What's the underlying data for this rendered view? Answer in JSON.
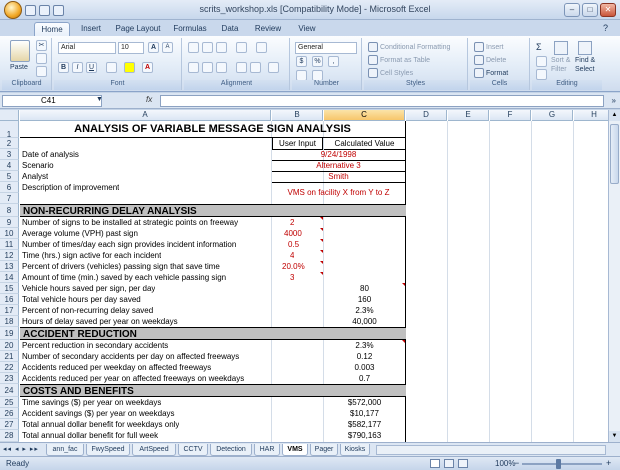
{
  "window": {
    "title": "scrits_workshop.xls  [Compatibility Mode] - Microsoft Excel"
  },
  "ribbon": {
    "tabs": [
      "Home",
      "Insert",
      "Page Layout",
      "Formulas",
      "Data",
      "Review",
      "View"
    ],
    "active_tab": "Home",
    "clipboard": {
      "paste": "Paste",
      "label": "Clipboard"
    },
    "font": {
      "name": "Arial",
      "size": "10",
      "label": "Font",
      "bold": "B",
      "italic": "I",
      "underline": "U",
      "grow": "A",
      "shrink": "A",
      "fontcolor": "A"
    },
    "alignment": {
      "label": "Alignment"
    },
    "number": {
      "format": "General",
      "currency": "$",
      "percent": "%",
      "comma": ",",
      "label": "Number"
    },
    "styles": {
      "conditional": "Conditional Formatting",
      "table": "Format as Table",
      "cell": "Cell Styles",
      "label": "Styles"
    },
    "cells": {
      "insert": "Insert",
      "delete": "Delete",
      "format": "Format",
      "label": "Cells"
    },
    "editing": {
      "sigma": "Σ",
      "sort": "Sort &",
      "filter": "Filter",
      "find": "Find &",
      "select": "Select",
      "label": "Editing"
    }
  },
  "formula_bar": {
    "name_box": "C41",
    "fx": "fx",
    "value": ""
  },
  "columns": [
    "A",
    "B",
    "C",
    "D",
    "E",
    "F",
    "G",
    "H"
  ],
  "selected_column": "C",
  "rows": [
    "1",
    "2",
    "3",
    "4",
    "5",
    "6",
    "7",
    "8",
    "9",
    "10",
    "11",
    "12",
    "13",
    "14",
    "15",
    "16",
    "17",
    "18",
    "19",
    "20",
    "21",
    "22",
    "23",
    "24",
    "25",
    "26",
    "27",
    "28"
  ],
  "sheet": {
    "title": "ANALYSIS OF VARIABLE MESSAGE SIGN ANALYSIS",
    "header_user_input": "User Input",
    "header_calculated": "Calculated Value",
    "date_label": "Date of analysis",
    "date_value": "9/24/1998",
    "scenario_label": "Scenario",
    "scenario_value": "Alternative 3",
    "analyst_label": "Analyst",
    "analyst_value": "Smith",
    "description_label": "Description of improvement",
    "description_value": "VMS on facility X from Y to Z",
    "section1": "NON-RECURRING DELAY ANALYSIS",
    "r9_label": "Number of signs to be installed at strategic points on freeway",
    "r9_value": "2",
    "r10_label": "Average volume (VPH) past sign",
    "r10_value": "4000",
    "r11_label": "Number of times/day each sign provides incident information",
    "r11_value": "0.5",
    "r12_label": "Time (hrs.) sign active for each incident",
    "r12_value": "4",
    "r13_label": "Percent of drivers (vehicles) passing sign that save time",
    "r13_value": "20.0%",
    "r14_label": "Amount of time (min.) saved by each vehicle passing sign",
    "r14_value": "3",
    "r15_label": "Vehicle hours saved per sign, per day",
    "r15_value": "80",
    "r16_label": "Total vehicle hours per day saved",
    "r16_value": "160",
    "r17_label": "Percent of non-recurring delay saved",
    "r17_value": "2.3%",
    "r18_label": "Hours of delay saved per year on weekdays",
    "r18_value": "40,000",
    "section2": "ACCIDENT REDUCTION",
    "r20_label": "Percent reduction in secondary accidents",
    "r20_value": "2.3%",
    "r21_label": "Number of secondary accidents per day on affected freeways",
    "r21_value": "0.12",
    "r22_label": "Accidents reduced per weekday on affected freeways",
    "r22_value": "0.003",
    "r23_label": "Accidents reduced per year on affected freeways on weekdays",
    "r23_value": "0.7",
    "section3": "COSTS AND BENEFITS",
    "r25_label": "Time savings ($) per year on weekdays",
    "r25_value": "$572,000",
    "r26_label": "Accident savings ($) per year on weekdays",
    "r26_value": "$10,177",
    "r27_label": "Total annual dollar benefit for weekdays only",
    "r27_value": "$582,177",
    "r28_label": "Total annual dollar benefit for full week",
    "r28_value": "$790,163"
  },
  "sheet_tabs": [
    "ann_fac",
    "FwySpeed",
    "ArtSpeed",
    "CCTV",
    "Detection",
    "HAR",
    "VMS",
    "Pager",
    "Kiosks"
  ],
  "active_sheet": "VMS",
  "status": {
    "ready": "Ready",
    "zoom": "100%"
  }
}
